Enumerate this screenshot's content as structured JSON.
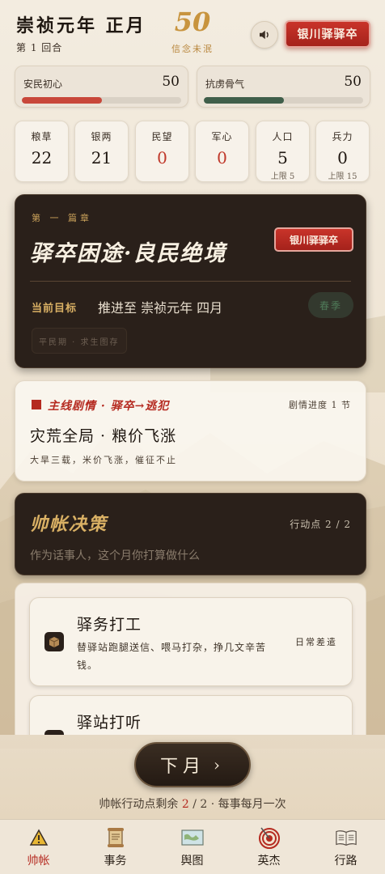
{
  "header": {
    "era": "崇祯元年 正月",
    "turn": "第 1 回合",
    "faith_value": "50",
    "faith_label": "信念未泯",
    "stamp_label": "银川驿驿卒"
  },
  "bars": [
    {
      "label": "安民初心",
      "value": "50",
      "fill": 0.5,
      "color": "#c8473a"
    },
    {
      "label": "抗虏骨气",
      "value": "50",
      "fill": 0.5,
      "color": "#3f5e4a"
    }
  ],
  "resources": [
    {
      "label": "粮草",
      "value": "22",
      "cap": "",
      "alert": false
    },
    {
      "label": "银两",
      "value": "21",
      "cap": "",
      "alert": false
    },
    {
      "label": "民望",
      "value": "0",
      "cap": "",
      "alert": true
    },
    {
      "label": "军心",
      "value": "0",
      "cap": "",
      "alert": true
    },
    {
      "label": "人口",
      "value": "5",
      "cap": "上限 5",
      "alert": false
    },
    {
      "label": "兵力",
      "value": "0",
      "cap": "上限 15",
      "alert": false
    }
  ],
  "chapter": {
    "tag": "第 一 篇章",
    "title": "驿卒困途·良民绝境",
    "stamp": "银川驿驿卒",
    "goal_label": "当前目标",
    "goal": "推进至 崇祯元年 四月",
    "season": "春季",
    "subtitle": "平民期 · 求生图存"
  },
  "story": {
    "label": "主线剧情 · 驿卒→逃犯",
    "progress": "剧情进度 1 节",
    "title": "灾荒全局 · 粮价飞涨",
    "desc": "大旱三载，米价飞涨，催征不止"
  },
  "decision": {
    "title": "帅帐决策",
    "action_points": "行动点 2 / 2",
    "subtitle": "作为话事人，这个月你打算做什么"
  },
  "actions": [
    {
      "title": "驿务打工",
      "desc": "替驿站跑腿送信、喂马打杂，挣几文辛苦钱。",
      "tag": "日常差遣",
      "icon": "box-icon"
    },
    {
      "title": "驿站打听",
      "desc": "",
      "tag": "",
      "icon": "ear-icon"
    }
  ],
  "bottom": {
    "next_label": "下月",
    "chevron": "›",
    "ap_prefix": "帅帐行动点剩余 ",
    "ap_remaining": "2",
    "ap_suffix": " / 2 · 每事每月一次"
  },
  "nav": [
    {
      "label": "帅帐",
      "icon": "warning-tent-icon",
      "active": true
    },
    {
      "label": "事务",
      "icon": "scroll-icon",
      "active": false
    },
    {
      "label": "舆图",
      "icon": "map-icon",
      "active": false
    },
    {
      "label": "英杰",
      "icon": "target-icon",
      "active": false
    },
    {
      "label": "行路",
      "icon": "book-icon",
      "active": false
    }
  ]
}
